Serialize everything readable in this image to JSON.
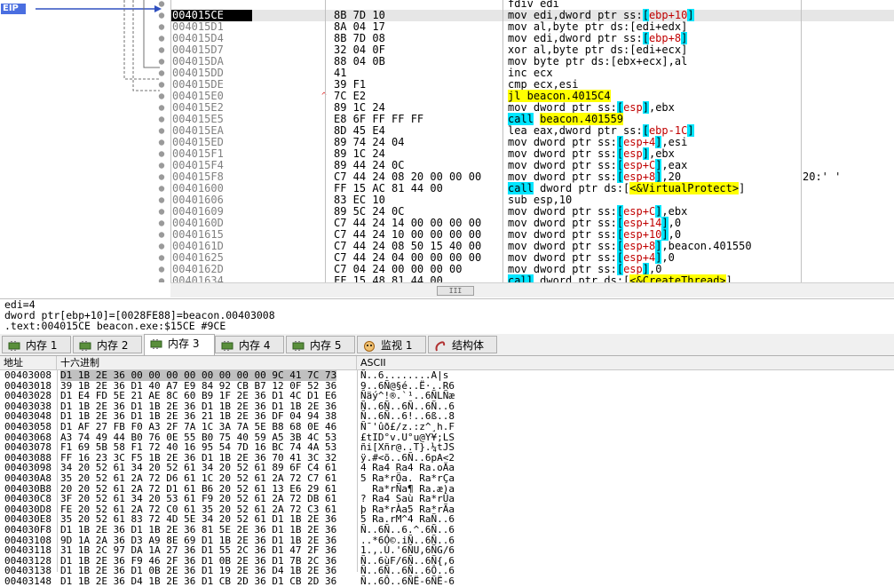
{
  "eip_label": "EIP",
  "disasm_rows": [
    {
      "addr": "",
      "bytes": "",
      "mark": "",
      "instr": [
        {
          "t": "fdiv edi"
        }
      ],
      "comment": ""
    },
    {
      "addr": "004015CE",
      "bytes": "8B 7D 10",
      "mark": "",
      "current": true,
      "instr": [
        {
          "t": "mov edi,dword ptr ss:"
        },
        {
          "t": "[",
          "c": "hlc"
        },
        {
          "t": "ebp+10",
          "c": "red"
        },
        {
          "t": "]",
          "c": "hlc"
        }
      ],
      "comment": ""
    },
    {
      "addr": "004015D1",
      "bytes": "8A 04 17",
      "mark": "",
      "instr": [
        {
          "t": "mov al,byte ptr ds:[edi+edx]"
        }
      ],
      "comment": ""
    },
    {
      "addr": "004015D4",
      "bytes": "8B 7D 08",
      "mark": "",
      "instr": [
        {
          "t": "mov edi,dword ptr ss:"
        },
        {
          "t": "[",
          "c": "hlc"
        },
        {
          "t": "ebp+8",
          "c": "red"
        },
        {
          "t": "]",
          "c": "hlc"
        }
      ],
      "comment": ""
    },
    {
      "addr": "004015D7",
      "bytes": "32 04 0F",
      "mark": "",
      "instr": [
        {
          "t": "xor al,byte ptr ds:[edi+ecx]"
        }
      ],
      "comment": ""
    },
    {
      "addr": "004015DA",
      "bytes": "88 04 0B",
      "mark": "",
      "instr": [
        {
          "t": "mov byte ptr ds:[ebx+ecx],al"
        }
      ],
      "comment": ""
    },
    {
      "addr": "004015DD",
      "bytes": "41",
      "mark": "",
      "instr": [
        {
          "t": "inc ecx"
        }
      ],
      "comment": ""
    },
    {
      "addr": "004015DE",
      "bytes": "39 F1",
      "mark": "",
      "instr": [
        {
          "t": "cmp ecx,esi"
        }
      ],
      "comment": ""
    },
    {
      "addr": "004015E0",
      "bytes": "7C E2",
      "mark": "^",
      "instr": [
        {
          "t": "jl beacon.4015C4",
          "c": "hl"
        }
      ],
      "comment": ""
    },
    {
      "addr": "004015E2",
      "bytes": "89 1C 24",
      "mark": "",
      "instr": [
        {
          "t": "mov dword ptr ss:"
        },
        {
          "t": "[",
          "c": "hlc"
        },
        {
          "t": "esp",
          "c": "red"
        },
        {
          "t": "]",
          "c": "hlc"
        },
        {
          "t": ",ebx"
        }
      ],
      "comment": ""
    },
    {
      "addr": "004015E5",
      "bytes": "E8 6F FF FF FF",
      "mark": "",
      "instr": [
        {
          "t": "call",
          "c": "hlc"
        },
        {
          "t": " "
        },
        {
          "t": "beacon.401559",
          "c": "hl"
        }
      ],
      "comment": ""
    },
    {
      "addr": "004015EA",
      "bytes": "8D 45 E4",
      "mark": "",
      "instr": [
        {
          "t": "lea eax,dword ptr ss:"
        },
        {
          "t": "[",
          "c": "hlc"
        },
        {
          "t": "ebp-1C",
          "c": "red"
        },
        {
          "t": "]",
          "c": "hlc"
        }
      ],
      "comment": ""
    },
    {
      "addr": "004015ED",
      "bytes": "89 74 24 04",
      "mark": "",
      "instr": [
        {
          "t": "mov dword ptr ss:"
        },
        {
          "t": "[",
          "c": "hlc"
        },
        {
          "t": "esp+4",
          "c": "red"
        },
        {
          "t": "]",
          "c": "hlc"
        },
        {
          "t": ",esi"
        }
      ],
      "comment": ""
    },
    {
      "addr": "004015F1",
      "bytes": "89 1C 24",
      "mark": "",
      "instr": [
        {
          "t": "mov dword ptr ss:"
        },
        {
          "t": "[",
          "c": "hlc"
        },
        {
          "t": "esp",
          "c": "red"
        },
        {
          "t": "]",
          "c": "hlc"
        },
        {
          "t": ",ebx"
        }
      ],
      "comment": ""
    },
    {
      "addr": "004015F4",
      "bytes": "89 44 24 0C",
      "mark": "",
      "instr": [
        {
          "t": "mov dword ptr ss:"
        },
        {
          "t": "[",
          "c": "hlc"
        },
        {
          "t": "esp+C",
          "c": "red"
        },
        {
          "t": "]",
          "c": "hlc"
        },
        {
          "t": ",eax"
        }
      ],
      "comment": ""
    },
    {
      "addr": "004015F8",
      "bytes": "C7 44 24 08 20 00 00 00",
      "mark": "",
      "instr": [
        {
          "t": "mov dword ptr ss:"
        },
        {
          "t": "[",
          "c": "hlc"
        },
        {
          "t": "esp+8",
          "c": "red"
        },
        {
          "t": "]",
          "c": "hlc"
        },
        {
          "t": ",20"
        }
      ],
      "comment": "20:' '"
    },
    {
      "addr": "00401600",
      "bytes": "FF 15 AC 81 44 00",
      "mark": "",
      "instr": [
        {
          "t": "call",
          "c": "hlc"
        },
        {
          "t": " dword ptr ds:["
        },
        {
          "t": "<&VirtualProtect>",
          "c": "hl"
        },
        {
          "t": "]"
        }
      ],
      "comment": ""
    },
    {
      "addr": "00401606",
      "bytes": "83 EC 10",
      "mark": "",
      "instr": [
        {
          "t": "sub esp,10"
        }
      ],
      "comment": ""
    },
    {
      "addr": "00401609",
      "bytes": "89 5C 24 0C",
      "mark": "",
      "instr": [
        {
          "t": "mov dword ptr ss:"
        },
        {
          "t": "[",
          "c": "hlc"
        },
        {
          "t": "esp+C",
          "c": "red"
        },
        {
          "t": "]",
          "c": "hlc"
        },
        {
          "t": ",ebx"
        }
      ],
      "comment": ""
    },
    {
      "addr": "0040160D",
      "bytes": "C7 44 24 14 00 00 00 00",
      "mark": "",
      "instr": [
        {
          "t": "mov dword ptr ss:"
        },
        {
          "t": "[",
          "c": "hlc"
        },
        {
          "t": "esp+14",
          "c": "red"
        },
        {
          "t": "]",
          "c": "hlc"
        },
        {
          "t": ",0"
        }
      ],
      "comment": ""
    },
    {
      "addr": "00401615",
      "bytes": "C7 44 24 10 00 00 00 00",
      "mark": "",
      "instr": [
        {
          "t": "mov dword ptr ss:"
        },
        {
          "t": "[",
          "c": "hlc"
        },
        {
          "t": "esp+10",
          "c": "red"
        },
        {
          "t": "]",
          "c": "hlc"
        },
        {
          "t": ",0"
        }
      ],
      "comment": ""
    },
    {
      "addr": "0040161D",
      "bytes": "C7 44 24 08 50 15 40 00",
      "mark": "",
      "instr": [
        {
          "t": "mov dword ptr ss:"
        },
        {
          "t": "[",
          "c": "hlc"
        },
        {
          "t": "esp+8",
          "c": "red"
        },
        {
          "t": "]",
          "c": "hlc"
        },
        {
          "t": ",beacon.401550"
        }
      ],
      "comment": ""
    },
    {
      "addr": "00401625",
      "bytes": "C7 44 24 04 00 00 00 00",
      "mark": "",
      "instr": [
        {
          "t": "mov dword ptr ss:"
        },
        {
          "t": "[",
          "c": "hlc"
        },
        {
          "t": "esp+4",
          "c": "red"
        },
        {
          "t": "]",
          "c": "hlc"
        },
        {
          "t": ",0"
        }
      ],
      "comment": ""
    },
    {
      "addr": "0040162D",
      "bytes": "C7 04 24 00 00 00 00",
      "mark": "",
      "instr": [
        {
          "t": "mov dword ptr ss:"
        },
        {
          "t": "[",
          "c": "hlc"
        },
        {
          "t": "esp",
          "c": "red"
        },
        {
          "t": "]",
          "c": "hlc"
        },
        {
          "t": ",0"
        }
      ],
      "comment": ""
    },
    {
      "addr": "00401634",
      "bytes": "FF 15 48 81 44 00",
      "mark": "",
      "instr": [
        {
          "t": "call",
          "c": "hlc"
        },
        {
          "t": " dword ptr ds:["
        },
        {
          "t": "<&CreateThread>",
          "c": "hl"
        },
        {
          "t": "]"
        }
      ],
      "comment": ""
    }
  ],
  "scroll_thumb": "III",
  "info": {
    "line1": "edi=4",
    "line2": "dword ptr[ebp+10]=[0028FE88]=beacon.00403008",
    "line3": ".text:004015CE beacon.exe:$15CE #9CE"
  },
  "tabs": [
    {
      "label": "内存 1",
      "icon": "memory-icon",
      "active": false
    },
    {
      "label": "内存 2",
      "icon": "memory-icon",
      "active": false
    },
    {
      "label": "内存 3",
      "icon": "memory-icon",
      "active": true
    },
    {
      "label": "内存 4",
      "icon": "memory-icon",
      "active": false
    },
    {
      "label": "内存 5",
      "icon": "memory-icon",
      "active": false
    },
    {
      "label": "监视 1",
      "icon": "watch-icon",
      "active": false
    },
    {
      "label": "结构体",
      "icon": "struct-icon",
      "active": false
    }
  ],
  "dump_headers": {
    "addr": "地址",
    "hex": "十六进制",
    "ascii": "ASCII"
  },
  "dump_rows": [
    {
      "addr": "00403008",
      "hex": "D1 1B 2E 36 00 00 00 00 00 00 00 00 9C 41 7C 73",
      "ascii": "Ñ..6........A|s"
    },
    {
      "addr": "00403018",
      "hex": "39 1B 2E 36 D1 40 A7 E9 84 92 CB B7 12 0F 52 36",
      "ascii": "9..6Ñ@§é..Ë·..R6"
    },
    {
      "addr": "00403028",
      "hex": "D1 E4 FD 5E 21 AE 8C 60 B9 1F 2E 36 D1 4C D1 E6",
      "ascii": "Ñäý^!®.`¹..6ÑLÑæ"
    },
    {
      "addr": "00403038",
      "hex": "D1 1B 2E 36 D1 1B 2E 36 D1 1B 2E 36 D1 1B 2E 36",
      "ascii": "Ñ..6Ñ..6Ñ..6Ñ..6"
    },
    {
      "addr": "00403048",
      "hex": "D1 1B 2E 36 D1 1B 2E 36 21 1B 2E 36 DF 04 94 38",
      "ascii": "Ñ..6Ñ..6!..6ß..8"
    },
    {
      "addr": "00403058",
      "hex": "D1 AF 27 FB F0 A3 2F 7A 1C 3A 7A 5E B8 68 0E 46",
      "ascii": "Ñ¯'ûð£/z.:z^¸h.F"
    },
    {
      "addr": "00403068",
      "hex": "A3 74 49 44 B0 76 0E 55 B0 75 40 59 A5 3B 4C 53",
      "ascii": "£tID°v.U°u@Y¥;LS"
    },
    {
      "addr": "00403078",
      "hex": "F1 69 5B 58 F1 72 40 16 95 54 7D 16 BC 74 4A 53",
      "ascii": "ñi[Xñr@..T}.¼tJS"
    },
    {
      "addr": "00403088",
      "hex": "FF 16 23 3C F5 1B 2E 36 D1 1B 2E 36 70 41 3C 32",
      "ascii": "ÿ.#<õ..6Ñ..6pA<2"
    },
    {
      "addr": "00403098",
      "hex": "34 20 52 61 34 20 52 61 34 20 52 61 89 6F C4 61",
      "ascii": "4 Ra4 Ra4 Ra.oÄa"
    },
    {
      "addr": "004030A8",
      "hex": "35 20 52 61 2A 72 D6 61 1C 20 52 61 2A 72 C7 61",
      "ascii": "5 Ra*rÖa. Ra*rÇa"
    },
    {
      "addr": "004030B8",
      "hex": "20 20 52 61 2A 72 D1 61 B6 20 52 61 13 E6 29 61",
      "ascii": "  Ra*rÑa¶ Ra.æ)a"
    },
    {
      "addr": "004030C8",
      "hex": "3F 20 52 61 34 20 53 61 F9 20 52 61 2A 72 DB 61",
      "ascii": "? Ra4 Saù Ra*rÛa"
    },
    {
      "addr": "004030D8",
      "hex": "FE 20 52 61 2A 72 C0 61 35 20 52 61 2A 72 C3 61",
      "ascii": "þ Ra*rÀa5 Ra*rÃa"
    },
    {
      "addr": "004030E8",
      "hex": "35 20 52 61 83 72 4D 5E 34 20 52 61 D1 1B 2E 36",
      "ascii": "5 Ra.rM^4 RaÑ..6"
    },
    {
      "addr": "004030F8",
      "hex": "D1 1B 2E 36 D1 1B 2E 36 81 5E 2E 36 D1 1B 2E 36",
      "ascii": "Ñ..6Ñ..6.^.6Ñ..6"
    },
    {
      "addr": "00403108",
      "hex": "9D 1A 2A 36 D3 A9 8E 69 D1 1B 2E 36 D1 1B 2E 36",
      "ascii": "..*6Ó©.iÑ..6Ñ..6"
    },
    {
      "addr": "00403118",
      "hex": "31 1B 2C 97 DA 1A 27 36 D1 55 2C 36 D1 47 2F 36",
      "ascii": "1.,.Ú.'6ÑU,6ÑG/6"
    },
    {
      "addr": "00403128",
      "hex": "D1 1B 2E 36 F9 46 2F 36 D1 0B 2E 36 D1 7B 2C 36",
      "ascii": "Ñ..6ùF/6Ñ..6Ñ{,6"
    },
    {
      "addr": "00403138",
      "hex": "D1 1B 2E 36 D1 0B 2E 36 D1 19 2E 36 D4 1B 2E 36",
      "ascii": "Ñ..6Ñ..6Ñ..6Ô..6"
    },
    {
      "addr": "00403148",
      "hex": "D1 1B 2E 36 D4 1B 2E 36 D1 CB 2D 36 D1 CB 2D 36",
      "ascii": "Ñ..6Ô..6ÑË-6ÑË-6"
    }
  ]
}
